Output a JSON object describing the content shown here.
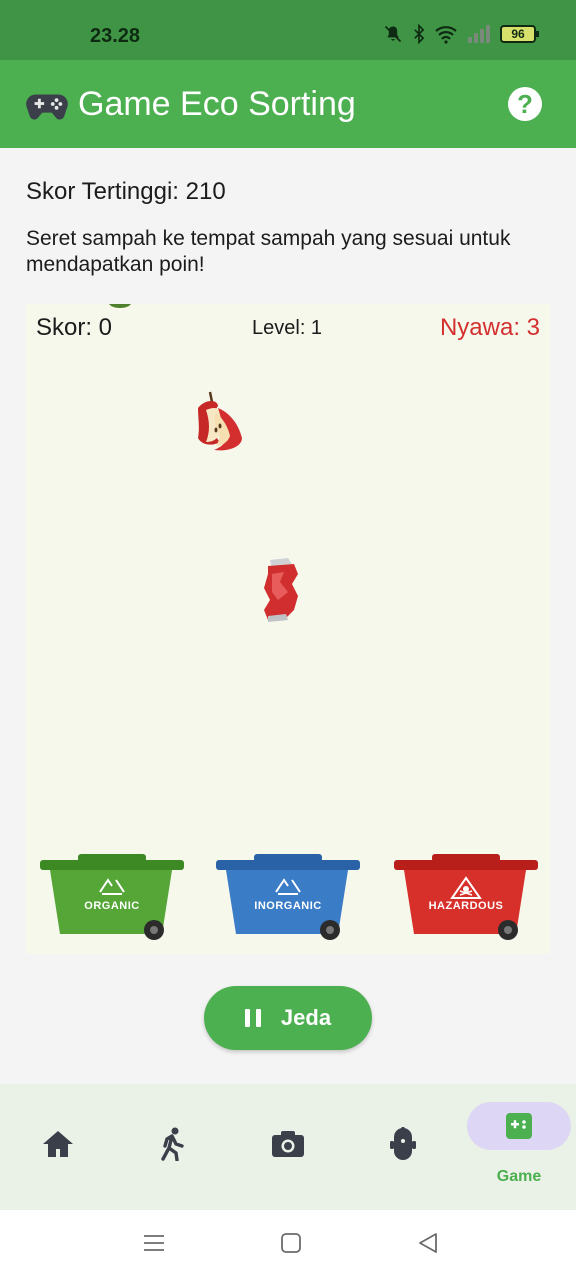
{
  "status_bar": {
    "time": "23.28",
    "battery": "96"
  },
  "app_bar": {
    "title": "Game Eco Sorting",
    "help_icon": "help-circle-icon",
    "help_label": "?"
  },
  "high_score": "Skor Tertinggi: 210",
  "instruction": "Seret sampah ke tempat sampah yang sesuai untuk mendapatkan poin!",
  "game": {
    "score": "Skor: 0",
    "level": "Level: 1",
    "lives": "Nyawa: 3",
    "items": [
      "apple-core",
      "crushed-can",
      "leaf"
    ],
    "bins": [
      {
        "label": "ORGANIC",
        "color": "#4a9a2f",
        "icon": "recycle-icon"
      },
      {
        "label": "INORGANIC",
        "color": "#2f6fb6",
        "icon": "recycle-icon"
      },
      {
        "label": "HAZARDOUS",
        "color": "#d12a26",
        "icon": "skull-crossbones-icon"
      }
    ]
  },
  "pause_button": {
    "label": "Jeda",
    "icon": "pause-icon"
  },
  "bottom_nav": {
    "items": [
      {
        "icon": "home-icon"
      },
      {
        "icon": "walking-person-icon"
      },
      {
        "icon": "camera-icon"
      },
      {
        "icon": "robot-icon"
      },
      {
        "icon": "game-controller-icon",
        "label": "Game",
        "active": true
      }
    ]
  },
  "colors": {
    "primary": "#4caf50",
    "status_bar": "#3f9545",
    "lives_red": "#d32f2f",
    "game_bg": "#f6f8ec"
  }
}
